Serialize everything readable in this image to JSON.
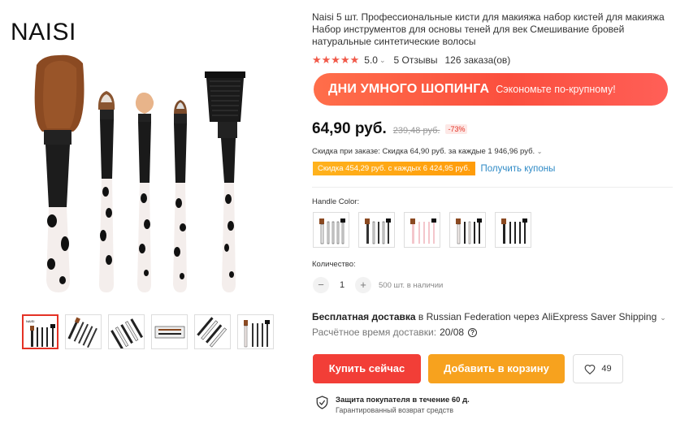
{
  "gallery": {
    "brand": "NAISI",
    "thumbnails": [
      {
        "name": "thumb-1"
      },
      {
        "name": "thumb-2"
      },
      {
        "name": "thumb-3"
      },
      {
        "name": "thumb-4"
      },
      {
        "name": "thumb-5"
      },
      {
        "name": "thumb-6"
      }
    ]
  },
  "product": {
    "title": "Naisi 5 шт. Профессиональные кисти для макияжа набор кистей для макияжа Набор инструментов для основы теней для век Смешивание бровей натуральные синтетические волосы",
    "rating": {
      "stars": "★★★★★",
      "value": "5.0",
      "reviews": "5 Отзывы",
      "orders": "126 заказа(ов)"
    }
  },
  "promo_banner": {
    "title": "ДНИ УМНОГО ШОПИНГА",
    "subtitle": "Сэкономьте по-крупному!"
  },
  "price": {
    "current": "64,90 руб.",
    "original": "239,48 руб.",
    "discount": "-73%"
  },
  "discounts": {
    "order_discount": "Скидка при заказе: Скидка 64,90 руб. за каждые 1 946,96 руб.",
    "coupon_tag": "Скидка 454,29 руб. с каждых 6 424,95 руб.",
    "coupon_link": "Получить купоны"
  },
  "options": {
    "color_label": "Handle Color:",
    "swatches": [
      {
        "name": "white-handle"
      },
      {
        "name": "white-black-handle"
      },
      {
        "name": "pink-handle"
      },
      {
        "name": "cow-print-handle"
      },
      {
        "name": "black-handle"
      }
    ]
  },
  "quantity": {
    "label": "Количество:",
    "minus": "−",
    "value": "1",
    "plus": "+",
    "stock": "500 шт. в наличии"
  },
  "shipping": {
    "title": "Бесплатная доставка",
    "detail": " в Russian Federation через AliExpress Saver Shipping",
    "eta_label": "Расчётное время доставки:",
    "eta_value": "20/08",
    "help": "?"
  },
  "actions": {
    "buy_now": "Купить сейчас",
    "add_to_cart": "Добавить в корзину",
    "wishlist_count": "49"
  },
  "protection": {
    "title": "Защита покупателя в течение 60 д.",
    "subtitle": "Гарантированный возврат средств"
  },
  "colors": {
    "accent_red": "#f23e37",
    "cart_orange": "#f7a21e",
    "star_red": "#f15a4a",
    "link_blue": "#2e8ac6"
  }
}
